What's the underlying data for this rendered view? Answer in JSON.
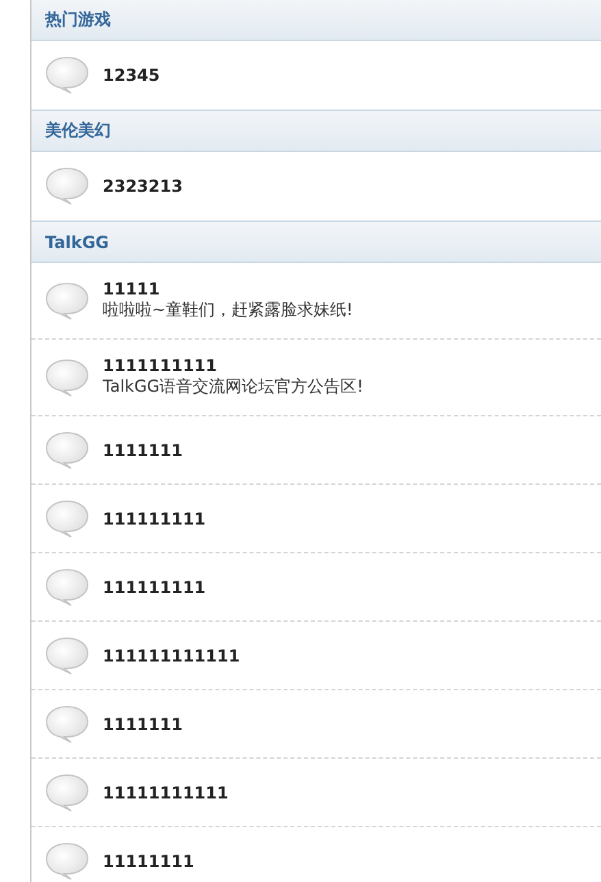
{
  "sections": [
    {
      "title": "热门游戏",
      "forums": [
        {
          "name": "12345"
        }
      ]
    },
    {
      "title": "美伦美幻",
      "forums": [
        {
          "name": "2323213"
        }
      ]
    },
    {
      "title": "TalkGG",
      "forums": [
        {
          "name": "11111",
          "description": "啦啦啦~童鞋们，赶紧露脸求妹纸!"
        },
        {
          "name": "1111111111",
          "description": "TalkGG语音交流网论坛官方公告区!"
        },
        {
          "name": "1111111"
        },
        {
          "name": "111111111"
        },
        {
          "name": "111111111"
        },
        {
          "name": "111111111111"
        },
        {
          "name": "1111111"
        },
        {
          "name": "11111111111"
        },
        {
          "name": "11111111"
        }
      ]
    }
  ]
}
